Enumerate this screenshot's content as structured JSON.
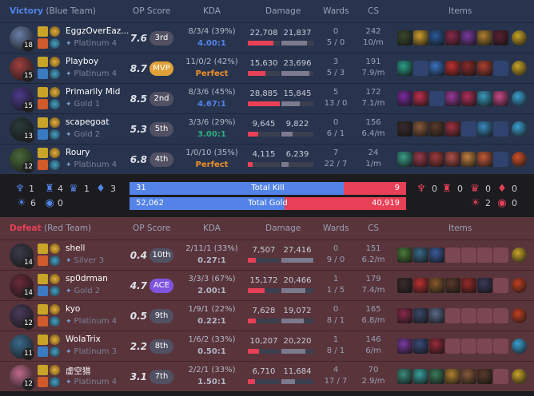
{
  "headers": {
    "op_score": "OP Score",
    "kda": "KDA",
    "damage": "Damage",
    "wards": "Wards",
    "cs": "CS",
    "items": "Items"
  },
  "blue_team": {
    "result": "Victory",
    "team_label": "(Blue Team)",
    "accent": "#5383e8",
    "players": [
      {
        "name": "EggzOverEaz...",
        "level": "18",
        "rank": "Platinum 4",
        "op_score": "7.6",
        "badge": "3rd",
        "kda_line": "8/3/4 (39%)",
        "kda_ratio": "4.00:1",
        "kda_color": "#5383e8",
        "dmg_dealt": "22,708",
        "dmg_dealt_frac": 0.79,
        "dmg_taken": "21,837",
        "dmg_taken_frac": 0.8,
        "wards": "0",
        "wards_detail": "5 / 0",
        "cs": "242",
        "cs_per_min": "10/m",
        "champ_color": "#6a7fa8",
        "items": [
          "#384a2e",
          "#d0a030",
          "#2a5a9a",
          "#8a2a4a",
          "#7a3aa0",
          "#b08030",
          "#5a2030"
        ],
        "trinket": "#c8a428"
      },
      {
        "name": "Playboy",
        "level": "15",
        "rank": "Platinum 4",
        "op_score": "8.7",
        "badge": "MVP",
        "kda_line": "11/0/2 (42%)",
        "kda_ratio": "Perfect",
        "kda_color": "#f0902a",
        "dmg_dealt": "15,630",
        "dmg_dealt_frac": 0.54,
        "dmg_taken": "23,696",
        "dmg_taken_frac": 0.87,
        "wards": "3",
        "wards_detail": "5 / 3",
        "cs": "191",
        "cs_per_min": "7.9/m",
        "champ_color": "#a04040",
        "items": [
          "#2aa08a",
          "empty",
          "#3a70c0",
          "#c03030",
          "#8a2a2a",
          "#b04030",
          "empty"
        ],
        "trinket": "#c8a428"
      },
      {
        "name": "Primarily Mid",
        "level": "15",
        "rank": "Gold 1",
        "op_score": "8.5",
        "badge": "2nd",
        "kda_line": "8/3/6 (45%)",
        "kda_ratio": "4.67:1",
        "kda_color": "#5383e8",
        "dmg_dealt": "28,885",
        "dmg_dealt_frac": 1.0,
        "dmg_taken": "15,845",
        "dmg_taken_frac": 0.58,
        "wards": "5",
        "wards_detail": "13 / 0",
        "cs": "172",
        "cs_per_min": "7.1/m",
        "champ_color": "#4a3a8a",
        "items": [
          "#7a2aa0",
          "#c03050",
          "empty",
          "#9a3a9a",
          "#b0305a",
          "#3a9ac0",
          "#c84a8a"
        ],
        "trinket": "#3aa0d0"
      },
      {
        "name": "scapegoat",
        "level": "13",
        "rank": "Gold 2",
        "op_score": "5.3",
        "badge": "5th",
        "kda_line": "3/3/6 (29%)",
        "kda_ratio": "3.00:1",
        "kda_color": "#2daf7f",
        "dmg_dealt": "9,645",
        "dmg_dealt_frac": 0.33,
        "dmg_taken": "9,822",
        "dmg_taken_frac": 0.36,
        "wards": "0",
        "wards_detail": "6 / 1",
        "cs": "156",
        "cs_per_min": "6.4/m",
        "champ_color": "#2a3a3a",
        "items": [
          "#3a2a2a",
          "#8a5a3a",
          "#5a3a2a",
          "#a03040",
          "empty",
          "#3a8ac0",
          "empty"
        ],
        "trinket": "#3aa0d0"
      },
      {
        "name": "Roury",
        "level": "12",
        "rank": "Platinum 4",
        "op_score": "6.8",
        "badge": "4th",
        "kda_line": "1/0/10 (35%)",
        "kda_ratio": "Perfect",
        "kda_color": "#f0902a",
        "dmg_dealt": "4,115",
        "dmg_dealt_frac": 0.14,
        "dmg_taken": "6,239",
        "dmg_taken_frac": 0.23,
        "wards": "7",
        "wards_detail": "22 / 7",
        "cs": "24",
        "cs_per_min": "1/m",
        "champ_color": "#4a6a3a",
        "items": [
          "#3aa08a",
          "#9a3a4a",
          "#a03a3a",
          "#b0504a",
          "#c08040",
          "#c85a3a",
          "empty"
        ],
        "trinket": "#d0502a"
      }
    ]
  },
  "red_team": {
    "result": "Defeat",
    "team_label": "(Red Team)",
    "accent": "#e84057",
    "players": [
      {
        "name": "shell",
        "level": "14",
        "rank": "Silver 3",
        "op_score": "0.4",
        "badge": "10th",
        "kda_line": "2/11/1 (33%)",
        "kda_ratio": "0.27:1",
        "kda_color": "#b4b8c6",
        "dmg_dealt": "7,507",
        "dmg_dealt_frac": 0.26,
        "dmg_taken": "27,416",
        "dmg_taken_frac": 1.0,
        "wards": "0",
        "wards_detail": "9 / 0",
        "cs": "151",
        "cs_per_min": "6.2/m",
        "champ_color": "#3a3a4a",
        "items": [
          "#4a7a3a",
          "#3a6a8a",
          "#3a5a9a",
          "empty",
          "empty",
          "empty",
          "empty"
        ],
        "trinket": "#c8a428"
      },
      {
        "name": "sp0drman",
        "level": "14",
        "rank": "Gold 2",
        "op_score": "4.7",
        "badge": "ACE",
        "kda_line": "3/3/3 (67%)",
        "kda_ratio": "2.00:1",
        "kda_color": "#b4b8c6",
        "dmg_dealt": "15,172",
        "dmg_dealt_frac": 0.53,
        "dmg_taken": "20,466",
        "dmg_taken_frac": 0.75,
        "wards": "1",
        "wards_detail": "1 / 5",
        "cs": "179",
        "cs_per_min": "7.4/m",
        "champ_color": "#6a2a3a",
        "items": [
          "#3a2a2a",
          "#c03030",
          "#8a5a2a",
          "#5a3a2a",
          "#9a2a2a",
          "#3a3a5a",
          "empty"
        ],
        "trinket": "#c04020"
      },
      {
        "name": "kyo",
        "level": "12",
        "rank": "Platinum 4",
        "op_score": "0.5",
        "badge": "9th",
        "kda_line": "1/9/1 (22%)",
        "kda_ratio": "0.22:1",
        "kda_color": "#b4b8c6",
        "dmg_dealt": "7,628",
        "dmg_dealt_frac": 0.26,
        "dmg_taken": "19,072",
        "dmg_taken_frac": 0.7,
        "wards": "0",
        "wards_detail": "8 / 1",
        "cs": "165",
        "cs_per_min": "6.8/m",
        "champ_color": "#4a3a5a",
        "items": [
          "#8a2a4a",
          "#3a4a6a",
          "#5a6a8a",
          "empty",
          "empty",
          "empty",
          "empty"
        ],
        "trinket": "#c04020"
      },
      {
        "name": "WolaTrix",
        "level": "11",
        "rank": "Platinum 3",
        "op_score": "2.2",
        "badge": "8th",
        "kda_line": "1/6/2 (33%)",
        "kda_ratio": "0.50:1",
        "kda_color": "#b4b8c6",
        "dmg_dealt": "10,207",
        "dmg_dealt_frac": 0.35,
        "dmg_taken": "20,220",
        "dmg_taken_frac": 0.74,
        "wards": "1",
        "wards_detail": "8 / 1",
        "cs": "146",
        "cs_per_min": "6/m",
        "champ_color": "#3a6a8a",
        "items": [
          "#7a3aa0",
          "#3a4a7a",
          "#9a2a3a",
          "empty",
          "empty",
          "empty",
          "empty"
        ],
        "trinket": "#3aa0d0"
      },
      {
        "name": "虚空猎",
        "level": "12",
        "rank": "Platinum 4",
        "op_score": "3.1",
        "badge": "7th",
        "kda_line": "2/2/1 (33%)",
        "kda_ratio": "1.50:1",
        "kda_color": "#b4b8c6",
        "dmg_dealt": "6,710",
        "dmg_dealt_frac": 0.23,
        "dmg_taken": "11,684",
        "dmg_taken_frac": 0.43,
        "wards": "4",
        "wards_detail": "17 / 7",
        "cs": "70",
        "cs_per_min": "2.9/m",
        "champ_color": "#c06a8a",
        "items": [
          "#3a8a7a",
          "#3aa0a0",
          "#3a7a5a",
          "#b08030",
          "#8a5a3a",
          "#5a3a2a",
          "empty"
        ],
        "trinket": "#c8a428"
      }
    ]
  },
  "summary": {
    "total_kill_label": "Total Kill",
    "total_gold_label": "Total Gold",
    "blue_kills": "31",
    "red_kills": "9",
    "kill_share_blue": 0.775,
    "blue_gold": "52,062",
    "red_gold": "40,919",
    "gold_share_blue": 0.56,
    "blue_objectives": {
      "baron": "1",
      "dragon": "4",
      "herald": "1",
      "tower": "3",
      "grub": "6",
      "inhib": "0"
    },
    "red_objectives": {
      "baron": "0",
      "dragon": "0",
      "herald": "0",
      "tower": "0",
      "grub": "2",
      "inhib": "0"
    }
  }
}
